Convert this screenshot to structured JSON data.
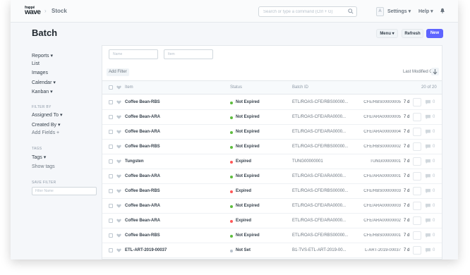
{
  "brand": {
    "line1": "frappé",
    "line2": "wave"
  },
  "breadcrumb": "Stock",
  "search": {
    "placeholder": "Search or type a command (Ctrl + G)"
  },
  "avatar_letter": "A",
  "nav": {
    "settings": "Settings",
    "help": "Help"
  },
  "page": {
    "title": "Batch"
  },
  "actions": {
    "menu": "Menu",
    "refresh": "Refresh",
    "new": "New"
  },
  "sidebar": {
    "reports": "Reports",
    "list": "List",
    "images": "Images",
    "calendar": "Calendar",
    "kanban": "Kanban",
    "filter_by_label": "FILTER BY",
    "assigned_to": "Assigned To",
    "created_by": "Created By",
    "add_fields": "Add Fields",
    "tags_label": "TAGS",
    "tags": "Tags",
    "show_tags": "Show tags",
    "save_filter_label": "SAVE FILTER",
    "filter_name_placeholder": "Filter Name"
  },
  "filters": {
    "name_placeholder": "Name",
    "item_placeholder": "Item",
    "add_filter": "Add Filter",
    "sort_label": "Last Modified On"
  },
  "columns": {
    "item": "Item",
    "status": "Status",
    "batch_id": "Batch ID",
    "count": "20 of 20"
  },
  "colors": {
    "green": "#5ebd3e",
    "red": "#ff5858",
    "gray": "#b8c2cc",
    "primary": "#5e64ff"
  },
  "rows": [
    {
      "item": "Coffee Bean-RBS",
      "status": "Not Expired",
      "status_color": "#5ebd3e",
      "batch_id": "ETL/ROAS-CFE/RBS00000...",
      "name": "CFE/RBS00000005",
      "modified": "7 d",
      "comments": "0"
    },
    {
      "item": "Coffee Bean-ARA",
      "status": "Not Expired",
      "status_color": "#5ebd3e",
      "batch_id": "ETL/ROAS-CFE/ARA0000...",
      "name": "CFE/ARA00000005",
      "modified": "7 d",
      "comments": "0"
    },
    {
      "item": "Coffee Bean-ARA",
      "status": "Not Expired",
      "status_color": "#5ebd3e",
      "batch_id": "ETL/ROAS-CFE/ARA0000...",
      "name": "CFE/ARA00000004",
      "modified": "7 d",
      "comments": "0"
    },
    {
      "item": "Coffee Bean-RBS",
      "status": "Not Expired",
      "status_color": "#5ebd3e",
      "batch_id": "ETL/ROAS-CFE/RBS00000...",
      "name": "CFE/RBS00000002",
      "modified": "7 d",
      "comments": "0"
    },
    {
      "item": "Tungsten",
      "status": "Expired",
      "status_color": "#ff5858",
      "batch_id": "TUNG00000001",
      "name": "TUNG00000001",
      "modified": "7 d",
      "comments": "0"
    },
    {
      "item": "Coffee Bean-ARA",
      "status": "Not Expired",
      "status_color": "#5ebd3e",
      "batch_id": "ETL/ROAS-CFE/ARA0000...",
      "name": "CFE/ARA00000001",
      "modified": "7 d",
      "comments": "0"
    },
    {
      "item": "Coffee Bean-RBS",
      "status": "Expired",
      "status_color": "#ff5858",
      "batch_id": "ETL/ROAS-CFE/RBS00000...",
      "name": "CFE/RBS00000003",
      "modified": "7 d",
      "comments": "0"
    },
    {
      "item": "Coffee Bean-ARA",
      "status": "Not Expired",
      "status_color": "#5ebd3e",
      "batch_id": "ETL/ROAS-CFE/ARA0000...",
      "name": "CFE/ARA00000003",
      "modified": "7 d",
      "comments": "0"
    },
    {
      "item": "Coffee Bean-ARA",
      "status": "Expired",
      "status_color": "#ff5858",
      "batch_id": "ETL/ROAS-CFE/ARA0000...",
      "name": "CFE/ARA00000002",
      "modified": "7 d",
      "comments": "0"
    },
    {
      "item": "Coffee Bean-RBS",
      "status": "Not Expired",
      "status_color": "#5ebd3e",
      "batch_id": "ETL/ROAS-CFE/RBS00000...",
      "name": "CFE/RBS00000001",
      "modified": "7 d",
      "comments": "0"
    },
    {
      "item": "ETL-ART-2019-00037",
      "status": "Not Set",
      "status_color": "#b8c2cc",
      "batch_id": "B1-TVS-ETL-ART-2019-00...",
      "name": "L-ART-2019-00037",
      "modified": "7 d",
      "comments": "0"
    }
  ]
}
